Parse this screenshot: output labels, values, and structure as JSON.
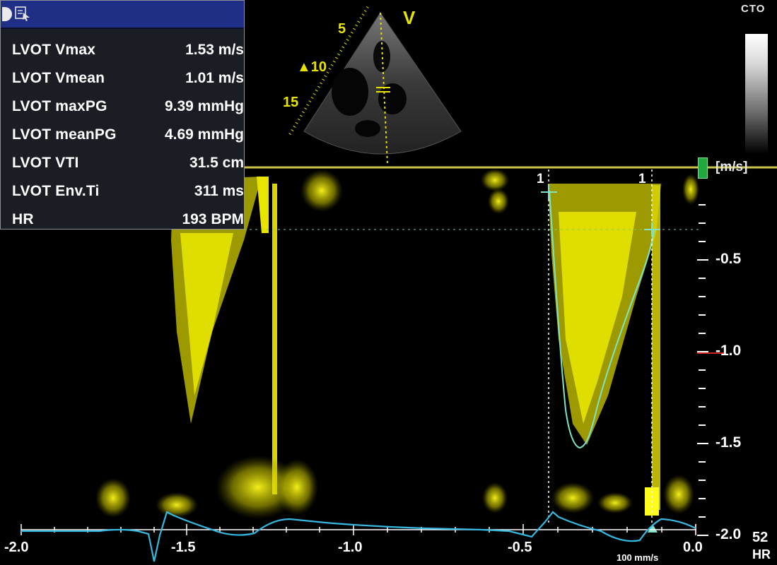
{
  "measurements": {
    "rows": [
      {
        "label": "LVOT Vmax",
        "value": "1.53 m/s"
      },
      {
        "label": "LVOT Vmean",
        "value": "1.01 m/s"
      },
      {
        "label": "LVOT maxPG",
        "value": "9.39 mmHg"
      },
      {
        "label": "LVOT meanPG",
        "value": "4.69 mmHg"
      },
      {
        "label": "LVOT VTI",
        "value": "31.5 cm"
      },
      {
        "label": "LVOT Env.Ti",
        "value": "311 ms"
      },
      {
        "label": "HR",
        "value": "193 BPM"
      }
    ]
  },
  "sector": {
    "view_label": "V",
    "depth_marks": [
      "5",
      "10",
      "15"
    ]
  },
  "grayscale": {
    "label": "CTO"
  },
  "velocity_axis": {
    "unit": "[m/s]",
    "ticks": [
      "-0.5",
      "-1.0",
      "-1.5",
      "-2.0"
    ]
  },
  "time_axis": {
    "ticks": [
      "-2.0",
      "-1.5",
      "-1.0",
      "-0.5",
      "0.0"
    ]
  },
  "ecg": {
    "hr_value": "52",
    "hr_label": "HR",
    "sweep_speed": "100 mm/s"
  },
  "cursors": {
    "left_label": "1",
    "right_label": "1"
  },
  "colors": {
    "doppler": "#e8e400",
    "trace": "#7fe3c8",
    "ecg": "#35b8e0",
    "panel_bg": "#1a1d23",
    "title_bar": "#1f2f86",
    "baseline": "#c9c64a"
  },
  "icons": [
    "record-icon",
    "tool-icon",
    "unit-handle-icon"
  ]
}
